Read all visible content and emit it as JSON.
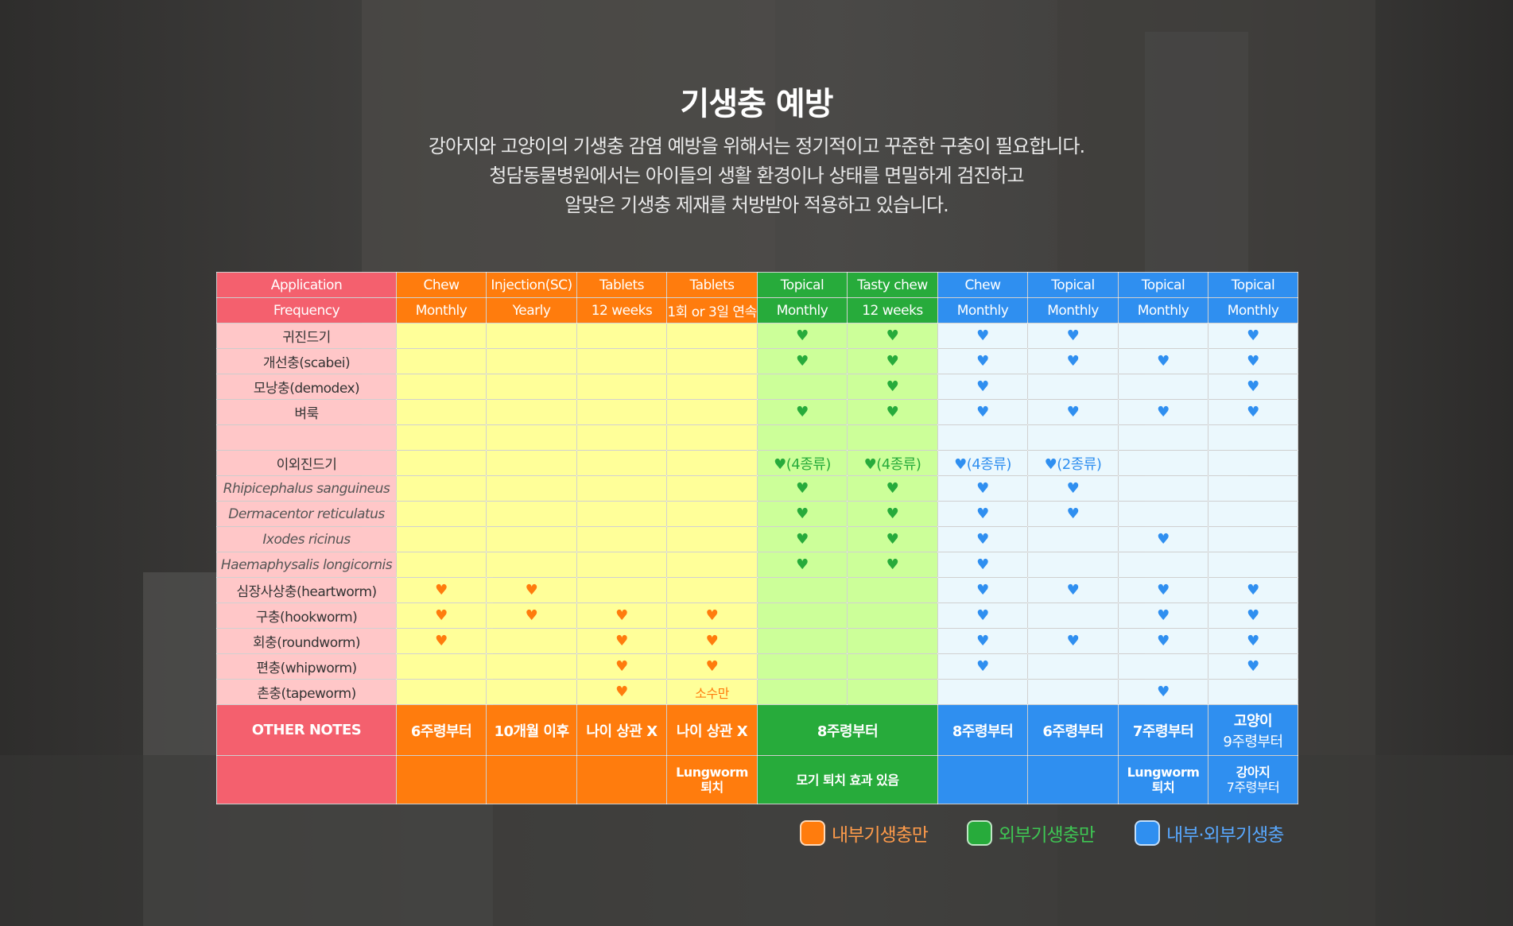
{
  "title": "기생충 예방",
  "intro": [
    "강아지와 고양이의 기생충 감염 예방을 위해서는 정기적이고 꾸준한 구충이 필요합니다.",
    "청담동물병원에서는 아이들의 생활 환경이나 상태를 면밀하게 검진하고",
    "알맞은 기생충 제재를 처방받아 적용하고 있습니다."
  ],
  "table": {
    "application_label": "Application",
    "frequency_label": "Frequency",
    "columns": [
      {
        "application": "Chew",
        "frequency": "Monthly",
        "group": "orange"
      },
      {
        "application": "Injection(SC)",
        "frequency": "Yearly",
        "group": "orange"
      },
      {
        "application": "Tablets",
        "frequency": "12 weeks",
        "group": "orange"
      },
      {
        "application": "Tablets",
        "frequency": "1회 or 3일 연속",
        "group": "orange"
      },
      {
        "application": "Topical",
        "frequency": "Monthly",
        "group": "green"
      },
      {
        "application": "Tasty chew",
        "frequency": "12 weeks",
        "group": "green"
      },
      {
        "application": "Chew",
        "frequency": "Monthly",
        "group": "blue"
      },
      {
        "application": "Topical",
        "frequency": "Monthly",
        "group": "blue"
      },
      {
        "application": "Topical",
        "frequency": "Monthly",
        "group": "blue"
      },
      {
        "application": "Topical",
        "frequency": "Monthly",
        "group": "blue"
      }
    ],
    "rows": [
      {
        "label": "귀진드기",
        "italic": false,
        "cells": [
          "",
          "",
          "",
          "",
          "heart",
          "heart",
          "heart",
          "heart",
          "",
          "heart"
        ]
      },
      {
        "label": "개선충(scabei)",
        "italic": false,
        "cells": [
          "",
          "",
          "",
          "",
          "heart",
          "heart",
          "heart",
          "heart",
          "heart",
          "heart"
        ]
      },
      {
        "label": "모낭충(demodex)",
        "italic": false,
        "cells": [
          "",
          "",
          "",
          "",
          "",
          "heart",
          "heart",
          "",
          "",
          "heart"
        ]
      },
      {
        "label": "벼룩",
        "italic": false,
        "cells": [
          "",
          "",
          "",
          "",
          "heart",
          "heart",
          "heart",
          "heart",
          "heart",
          "heart"
        ]
      },
      {
        "label": "",
        "italic": false,
        "cells": [
          "",
          "",
          "",
          "",
          "",
          "",
          "",
          "",
          "",
          ""
        ]
      },
      {
        "label": "이외진드기",
        "italic": false,
        "cells": [
          "",
          "",
          "",
          "",
          "(4종류)",
          "(4종류)",
          "(4종류)",
          "(2종류)",
          "",
          ""
        ]
      },
      {
        "label": "Rhipicephalus sanguineus",
        "italic": true,
        "cells": [
          "",
          "",
          "",
          "",
          "heart",
          "heart",
          "heart",
          "heart",
          "",
          ""
        ]
      },
      {
        "label": "Dermacentor reticulatus",
        "italic": true,
        "cells": [
          "",
          "",
          "",
          "",
          "heart",
          "heart",
          "heart",
          "heart",
          "",
          ""
        ]
      },
      {
        "label": "Ixodes ricinus",
        "italic": true,
        "cells": [
          "",
          "",
          "",
          "",
          "heart",
          "heart",
          "heart",
          "",
          "heart",
          ""
        ]
      },
      {
        "label": "Haemaphysalis longicornis",
        "italic": true,
        "cells": [
          "",
          "",
          "",
          "",
          "heart",
          "heart",
          "heart",
          "",
          "",
          ""
        ]
      },
      {
        "label": "심장사상충(heartworm)",
        "italic": false,
        "cells": [
          "heart",
          "heart",
          "",
          "",
          "",
          "",
          "heart",
          "heart",
          "heart",
          "heart"
        ]
      },
      {
        "label": "구충(hookworm)",
        "italic": false,
        "cells": [
          "heart",
          "heart",
          "heart",
          "heart",
          "",
          "",
          "heart",
          "",
          "heart",
          "heart"
        ]
      },
      {
        "label": "회충(roundworm)",
        "italic": false,
        "cells": [
          "heart",
          "",
          "heart",
          "heart",
          "",
          "",
          "heart",
          "heart",
          "heart",
          "heart"
        ]
      },
      {
        "label": "편충(whipworm)",
        "italic": false,
        "cells": [
          "",
          "",
          "heart",
          "heart",
          "",
          "",
          "heart",
          "",
          "",
          "heart"
        ]
      },
      {
        "label": "촌충(tapeworm)",
        "italic": false,
        "cells": [
          "",
          "",
          "heart",
          "소수만",
          "",
          "",
          "",
          "",
          "heart",
          ""
        ]
      }
    ],
    "notes_label": "OTHER NOTES",
    "notes": {
      "c1": "6주령부터",
      "c2": "10개월 이후",
      "c3": "나이 상관 X",
      "c4": "나이 상관 X",
      "green": "8주령부터",
      "c7": "8주령부터",
      "c8": "6주령부터",
      "c9": "7주령부터",
      "c10_title": "고양이",
      "c10_sub": "9주령부터"
    },
    "notes2": {
      "c4_line1": "Lungworm",
      "c4_line2": "퇴치",
      "green": "모기 퇴치 효과 있음",
      "c9_line1": "Lungworm",
      "c9_line2": "퇴치",
      "c10_title": "강아지",
      "c10_sub": "7주령부터"
    }
  },
  "legend": [
    {
      "label": "내부기생충만",
      "color": "#ff7c0d",
      "text_color": "#ff9b4a"
    },
    {
      "label": "외부기생충만",
      "color": "#27ab3b",
      "text_color": "#3ec653"
    },
    {
      "label": "내부·외부기생충",
      "color": "#2f8ff0",
      "text_color": "#58a8ff"
    }
  ],
  "colors": {
    "label_header": "#f4606e",
    "orange": "#ff7c0d",
    "green": "#27ab3b",
    "blue": "#2f8ff0"
  }
}
